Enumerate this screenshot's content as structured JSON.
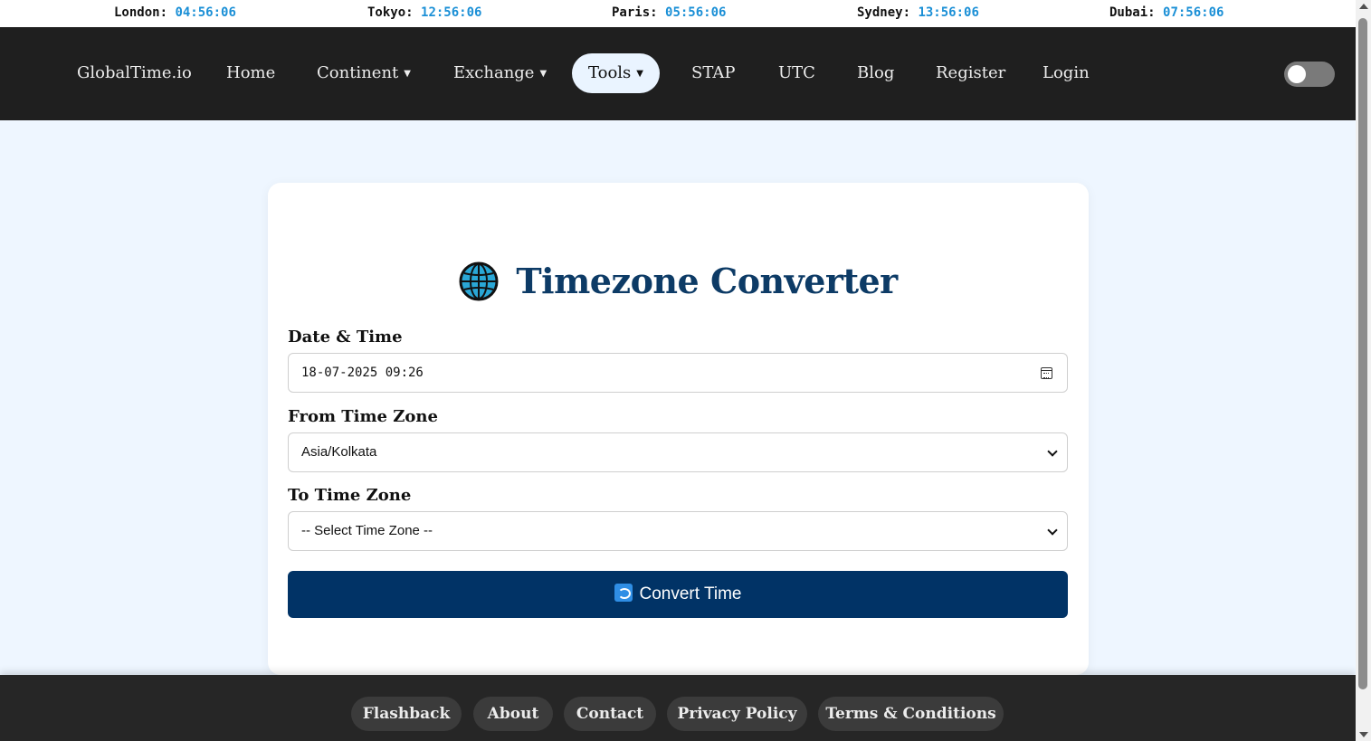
{
  "clocks": [
    {
      "city": "London:",
      "time": "04:56:06"
    },
    {
      "city": "Tokyo:",
      "time": "12:56:06"
    },
    {
      "city": "Paris:",
      "time": "05:56:06"
    },
    {
      "city": "Sydney:",
      "time": "13:56:06"
    },
    {
      "city": "Dubai:",
      "time": "07:56:06"
    }
  ],
  "nav": {
    "brand": "GlobalTime.io",
    "home": "Home",
    "continent": "Continent",
    "exchange": "Exchange",
    "tools": "Tools",
    "stap": "STAP",
    "utc": "UTC",
    "blog": "Blog",
    "register": "Register",
    "login": "Login",
    "caret": "▼"
  },
  "converter": {
    "title": "Timezone Converter",
    "date_label": "Date & Time",
    "date_value": "18-07-2025 09:26",
    "from_label": "From Time Zone",
    "from_value": "Asia/Kolkata",
    "to_label": "To Time Zone",
    "to_value": "-- Select Time Zone --",
    "button_label": "Convert Time"
  },
  "footer": {
    "links": [
      "Flashback",
      "About",
      "Contact",
      "Privacy Policy",
      "Terms & Conditions"
    ]
  },
  "colors": {
    "accent": "#013366",
    "title": "#0d3b66",
    "clock_time": "#1a8fd6",
    "navbar": "#1f1f1f"
  }
}
